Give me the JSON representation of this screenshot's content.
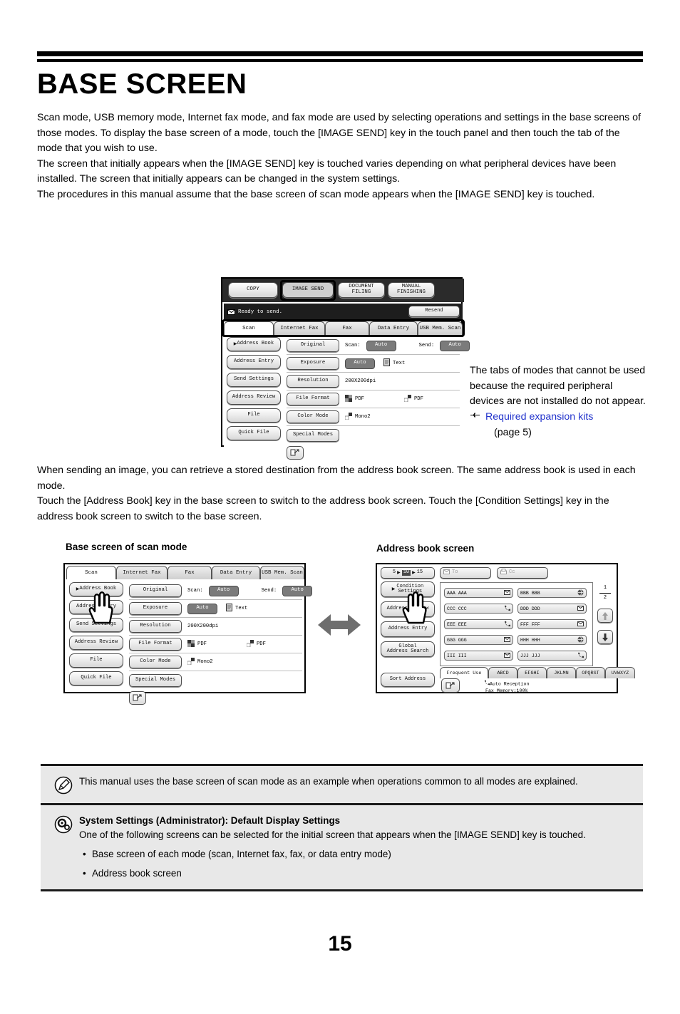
{
  "page": {
    "title": "BASE SCREEN",
    "folio": "15"
  },
  "intro": {
    "p1": "Scan mode, USB memory mode, Internet fax mode, and fax mode are used by selecting operations and settings in the base screens of those modes. To display the base screen of a mode, touch the [IMAGE SEND] key in the touch panel and then touch the tab of the mode that you wish to use.",
    "p2": "The screen that initially appears when the [IMAGE SEND] key is touched varies depending on what peripheral devices have been installed. The screen that initially appears can be changed in the system settings.",
    "p3": "The procedures in this manual assume that the base screen of scan mode appears when the [IMAGE SEND] key is touched."
  },
  "annotation": {
    "text": "The tabs of modes that cannot be used because the required peripheral devices are not installed do not appear.",
    "hand_icon": "pointing-hand-icon",
    "link": "Required expansion kits",
    "page_ref": "(page 5)"
  },
  "middle": {
    "p1": "When sending an image, you can retrieve a stored destination from the address book screen. The same address book is used in each mode.",
    "p2": "Touch the [Address Book] key in the base screen to switch to the address book screen. Touch the [Condition Settings] key in the address book screen to switch to the base screen."
  },
  "captions": {
    "base_screen": "Base screen of scan mode",
    "address_book": "Address book screen"
  },
  "touch_panel": {
    "mode_keys": [
      "COPY",
      "IMAGE SEND",
      "DOCUMENT\nFILING",
      "MANUAL\nFINISHING"
    ],
    "active_mode": "IMAGE SEND",
    "status_text": "Ready to send.",
    "status_icon": "envelope-icon",
    "resend_label": "Resend",
    "tabs": [
      "Scan",
      "Internet Fax",
      "Fax",
      "Data Entry",
      "USB Mem. Scan"
    ],
    "active_tab": "Scan",
    "left_keys": [
      "Address Book",
      "Address Entry",
      "Send Settings",
      "Address Review",
      "File",
      "Quick File"
    ],
    "rows": [
      {
        "key": "Original",
        "label1": "Scan:",
        "value1": "Auto",
        "label2": "Send:",
        "value2": "Auto"
      },
      {
        "key": "Exposure",
        "value1": "Auto",
        "icon": "document-icon",
        "label2": "Text"
      },
      {
        "key": "Resolution",
        "label1": "200X200dpi"
      },
      {
        "key": "File Format",
        "icon1": "checker-dark-icon",
        "label1": "PDF",
        "icon2": "checker-light-icon",
        "label2": "PDF"
      },
      {
        "key": "Color Mode",
        "icon1": "checker-light-icon",
        "label1": "Mono2"
      },
      {
        "key": "Special Modes"
      }
    ],
    "shortcut_icon": "custom-settings-icon"
  },
  "address_book_panel": {
    "counter": {
      "left": "5",
      "current": "10",
      "right": "15"
    },
    "left_keys": [
      "Condition\nSettings",
      "Address Review",
      "Address Entry",
      "Global\nAddress Search"
    ],
    "sort_key": "Sort Address",
    "to_key": {
      "label": "To",
      "icon": "envelope-icon"
    },
    "cc_key": {
      "label": "Cc",
      "icon": "fax-icon"
    },
    "entries": [
      {
        "name": "AAA AAA",
        "icon": "envelope-icon"
      },
      {
        "name": "BBB BBB",
        "icon": "internet-fax-icon"
      },
      {
        "name": "CCC CCC",
        "icon": "phone-icon"
      },
      {
        "name": "DDD DDD",
        "icon": "envelope-icon"
      },
      {
        "name": "EEE EEE",
        "icon": "phone-icon"
      },
      {
        "name": "FFF FFF",
        "icon": "envelope-icon"
      },
      {
        "name": "GGG GGG",
        "icon": "envelope-icon"
      },
      {
        "name": "HHH HHH",
        "icon": "internet-fax-icon"
      },
      {
        "name": "III III",
        "icon": "envelope-icon"
      },
      {
        "name": "JJJ JJJ",
        "icon": "phone-icon"
      }
    ],
    "page_current": "1",
    "page_total": "2",
    "scroll_up_icon": "arrow-up-icon",
    "scroll_down_icon": "arrow-down-icon",
    "index_tabs": [
      "Frequent Use",
      "ABCD",
      "EFGHI",
      "JKLMN",
      "OPQRST",
      "UVWXYZ"
    ],
    "active_index_tab": "Frequent Use",
    "status_line1": "Auto Reception",
    "status_line2": "Fax Memory:100%",
    "shortcut_icon": "custom-settings-icon"
  },
  "notes": [
    {
      "icon": "pencil-note-icon",
      "heading": "",
      "text": "This manual uses the base screen of scan mode as an example when operations common to all modes are explained.",
      "bullets": []
    },
    {
      "icon": "gear-settings-icon",
      "heading": "System Settings (Administrator): Default Display Settings",
      "text": "One of the following screens can be selected for the initial screen that appears when the [IMAGE SEND] key is touched.",
      "bullets": [
        "Base screen of each mode (scan, Internet fax, fax, or data entry mode)",
        "Address book screen"
      ]
    }
  ],
  "colors": {
    "link": "#2233cc",
    "arrow": "#6e6e6e",
    "note_bg": "#e8e8e8"
  }
}
